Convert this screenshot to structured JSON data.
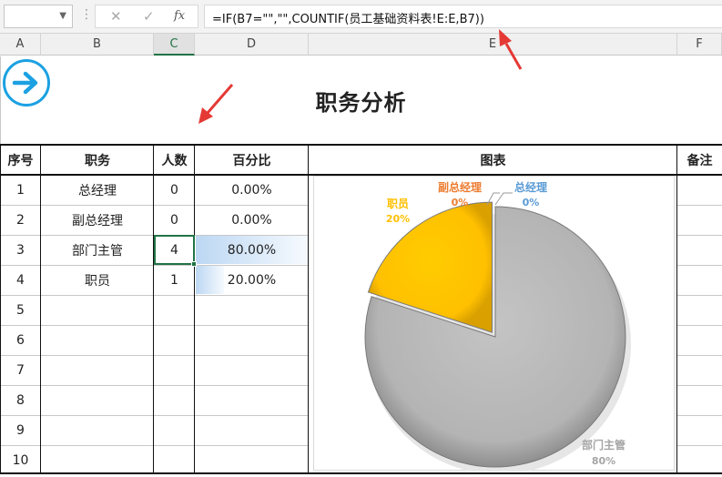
{
  "namebox": {
    "value": ""
  },
  "formula_bar": {
    "cancel_icon": "✕",
    "enter_icon": "✓",
    "fx_label": "fx",
    "formula": "=IF(B7=\"\",\"\",COUNTIF(员工基础资料表!E:E,B7))"
  },
  "columns": [
    "A",
    "B",
    "C",
    "D",
    "E",
    "F"
  ],
  "sheet": {
    "title": "职务分析",
    "headers": {
      "seq": "序号",
      "role": "职务",
      "count": "人数",
      "pct": "百分比",
      "chart": "图表",
      "notes": "备注"
    },
    "rows": [
      {
        "seq": "1",
        "role": "总经理",
        "count": "0",
        "pct": "0.00%",
        "pct_value": 0
      },
      {
        "seq": "2",
        "role": "副总经理",
        "count": "0",
        "pct": "0.00%",
        "pct_value": 0
      },
      {
        "seq": "3",
        "role": "部门主管",
        "count": "4",
        "pct": "80.00%",
        "pct_value": 0.8
      },
      {
        "seq": "4",
        "role": "职员",
        "count": "1",
        "pct": "20.00%",
        "pct_value": 0.2
      },
      {
        "seq": "5",
        "role": "",
        "count": "",
        "pct": ""
      },
      {
        "seq": "6",
        "role": "",
        "count": "",
        "pct": ""
      },
      {
        "seq": "7",
        "role": "",
        "count": "",
        "pct": ""
      },
      {
        "seq": "8",
        "role": "",
        "count": "",
        "pct": ""
      },
      {
        "seq": "9",
        "role": "",
        "count": "",
        "pct": ""
      },
      {
        "seq": "10",
        "role": "",
        "count": "",
        "pct": ""
      }
    ]
  },
  "colors": {
    "accent": "#217346",
    "arrow": "#1ba1e2",
    "bar": "#cfe2f7",
    "pie_gray": "#b4b4b4",
    "pie_gold": "#ffc000"
  },
  "chart_data": {
    "type": "pie",
    "categories": [
      "总经理",
      "副总经理",
      "部门主管",
      "职员"
    ],
    "values": [
      0,
      0,
      80,
      20
    ],
    "labels": [
      {
        "name": "总经理",
        "pct": "0%",
        "color": "#5b9bd5"
      },
      {
        "name": "副总经理",
        "pct": "0%",
        "color": "#ed7d31"
      },
      {
        "name": "部门主管",
        "pct": "80%",
        "color": "#a5a5a5"
      },
      {
        "name": "职员",
        "pct": "20%",
        "color": "#ffc000"
      }
    ]
  }
}
